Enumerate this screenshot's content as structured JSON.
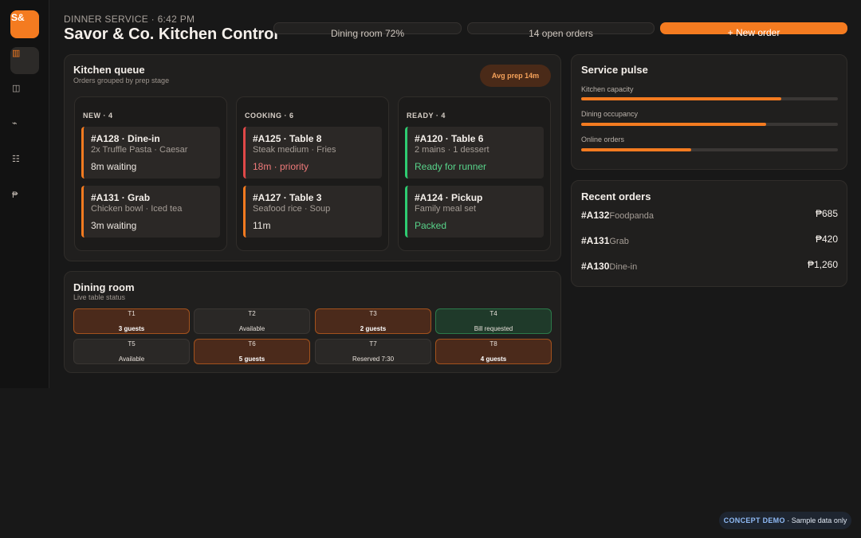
{
  "app": {
    "logo": "S&",
    "service_line": "DINNER SERVICE · 6:42 PM",
    "title": "Savor & Co. Kitchen Control"
  },
  "sidebar": {
    "items": [
      {
        "icon": "kitchen-icon",
        "glyph": "▥",
        "active": true
      },
      {
        "icon": "layout-icon",
        "glyph": "◫",
        "active": false
      },
      {
        "icon": "activity-icon",
        "glyph": "⌁",
        "active": false
      },
      {
        "icon": "list-icon",
        "glyph": "☷",
        "active": false
      },
      {
        "icon": "peso-icon",
        "glyph": "₱",
        "active": false
      }
    ]
  },
  "header": {
    "dining_chip": "Dining room 72%",
    "orders_chip": "14 open orders",
    "new_order": "+ New order"
  },
  "queue": {
    "title": "Kitchen queue",
    "subtitle": "Orders grouped by prep stage",
    "avg_prep": "Avg prep 14m",
    "columns": [
      {
        "title": "NEW · 4",
        "cards": [
          {
            "title": "#A128 · Dine-in",
            "items": "2x Truffle Pasta · Caesar",
            "status": "8m waiting",
            "tone": "orange"
          },
          {
            "title": "#A131 · Grab",
            "items": "Chicken bowl · Iced tea",
            "status": "3m waiting",
            "tone": "orange"
          }
        ]
      },
      {
        "title": "COOKING · 6",
        "cards": [
          {
            "title": "#A125 · Table 8",
            "items": "Steak medium · Fries",
            "status": "18m · priority",
            "tone": "red"
          },
          {
            "title": "#A127 · Table 3",
            "items": "Seafood rice · Soup",
            "status": "11m",
            "tone": "orange"
          }
        ]
      },
      {
        "title": "READY · 4",
        "cards": [
          {
            "title": "#A120 · Table 6",
            "items": "2 mains · 1 dessert",
            "status": "Ready for runner",
            "tone": "green"
          },
          {
            "title": "#A124 · Pickup",
            "items": "Family meal set",
            "status": "Packed",
            "tone": "green"
          }
        ]
      }
    ]
  },
  "dining": {
    "title": "Dining room",
    "subtitle": "Live table status",
    "tables": [
      {
        "name": "T1",
        "status": "3 guests",
        "state": "busy"
      },
      {
        "name": "T2",
        "status": "Available",
        "state": "free"
      },
      {
        "name": "T3",
        "status": "2 guests",
        "state": "busy"
      },
      {
        "name": "T4",
        "status": "Bill requested",
        "state": "bill"
      },
      {
        "name": "T5",
        "status": "Available",
        "state": "free"
      },
      {
        "name": "T6",
        "status": "5 guests",
        "state": "busy"
      },
      {
        "name": "T7",
        "status": "Reserved 7:30",
        "state": "free"
      },
      {
        "name": "T8",
        "status": "4 guests",
        "state": "busy"
      }
    ]
  },
  "pulse": {
    "title": "Service pulse",
    "metrics": [
      {
        "label": "Kitchen capacity",
        "value": 0.78
      },
      {
        "label": "Dining occupancy",
        "value": 0.72
      },
      {
        "label": "Online orders",
        "value": 0.43
      }
    ]
  },
  "recent": {
    "title": "Recent orders",
    "orders": [
      {
        "id": "#A132",
        "source": "Foodpanda",
        "amount": "₱685"
      },
      {
        "id": "#A131",
        "source": "Grab",
        "amount": "₱420"
      },
      {
        "id": "#A130",
        "source": "Dine-in",
        "amount": "₱1,260"
      }
    ]
  },
  "footer": {
    "demo_strong": "CONCEPT DEMO",
    "demo_rest": " · Sample data only"
  },
  "colors": {
    "accent": "#f47b20",
    "danger": "#e04848",
    "success": "#2ecc71"
  }
}
